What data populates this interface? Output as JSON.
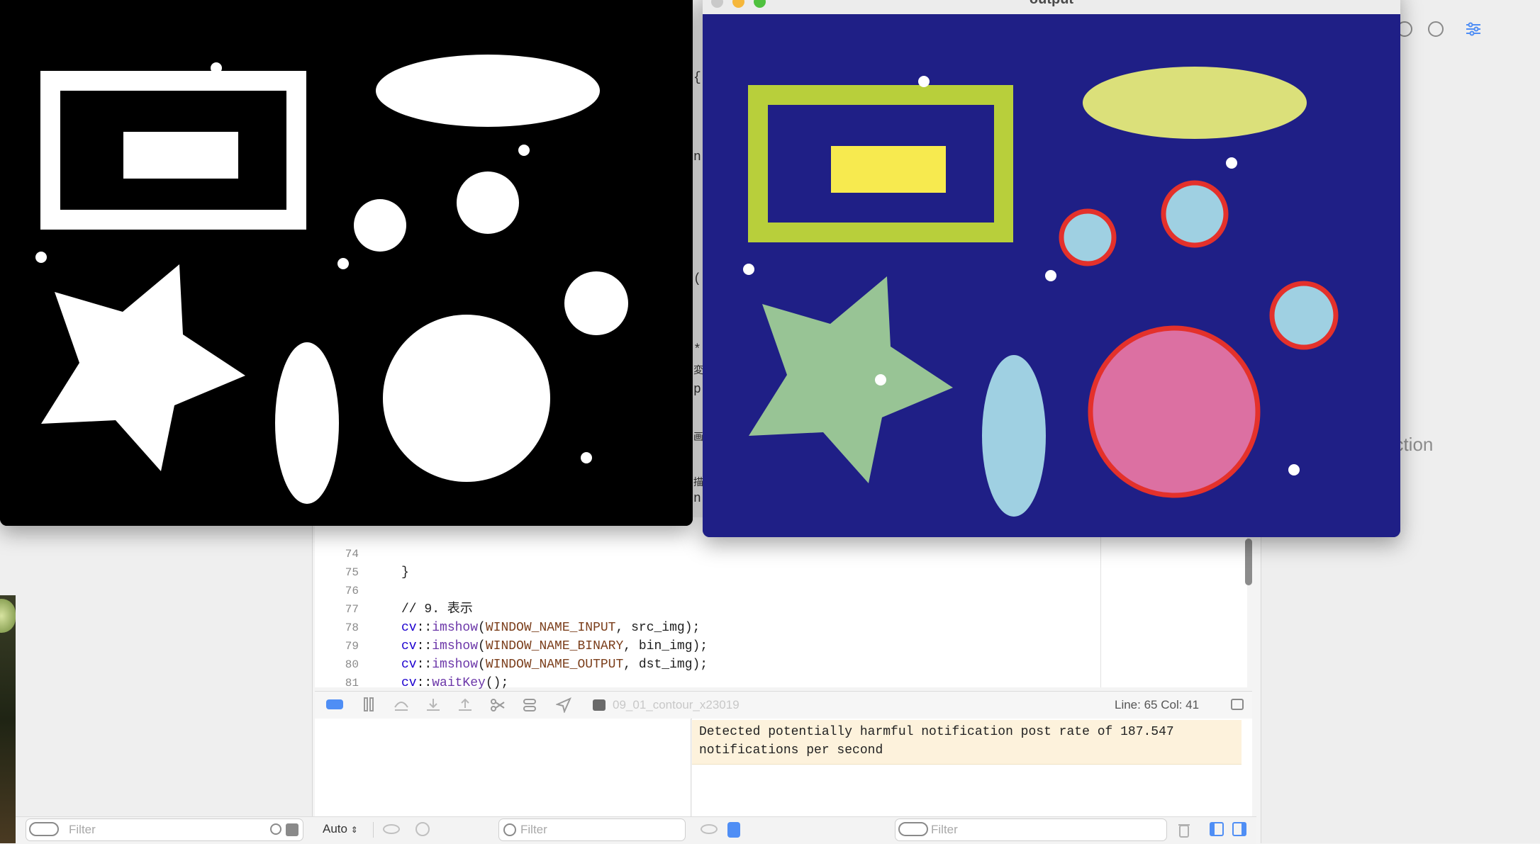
{
  "output_window": {
    "title": "output"
  },
  "editor": {
    "lines": [
      {
        "num": "74",
        "text": "}"
      },
      {
        "num": "75",
        "text": ""
      },
      {
        "num": "76",
        "comment": "// 9. 表示"
      },
      {
        "num": "77",
        "ns": "cv",
        "fn": "imshow",
        "arg1": "WINDOW_NAME_INPUT",
        "rest": ", src_img);"
      },
      {
        "num": "78",
        "ns": "cv",
        "fn": "imshow",
        "arg1": "WINDOW_NAME_BINARY",
        "rest": ", bin_img);"
      },
      {
        "num": "79",
        "ns": "cv",
        "fn": "imshow",
        "arg1": "WINDOW_NAME_OUTPUT",
        "rest": ", dst_img);"
      },
      {
        "num": "80",
        "ns": "cv",
        "fn": "waitKey",
        "arg1": "",
        "rest": "();"
      },
      {
        "num": "81",
        "text": ""
      }
    ],
    "partial_chars": [
      "{",
      "n",
      "(",
      "*",
      "変",
      "p",
      "画",
      "描",
      "n"
    ]
  },
  "debug_bar": {
    "scheme": "09_01_contour_x23019",
    "cursor": "Line: 65  Col: 41"
  },
  "console": {
    "message": "Detected potentially harmful notification post rate of 187.547 notifications per second"
  },
  "bottom_bar": {
    "left_filter_placeholder": "Filter",
    "auto_label": "Auto",
    "middle_filter_placeholder": "Filter",
    "right_filter_placeholder": "Filter"
  },
  "inspector": {
    "partial_text": "ection"
  },
  "colors": {
    "output_bg": "#1f1f86",
    "rect_frame": "#b8cf3b",
    "inner_rect": "#f7ea4f",
    "ellipse_top": "#dbe07a",
    "circle_fill": "#9fd0e2",
    "contour": "#e4312b",
    "big_circle": "#dc70a2",
    "star": "#98c495",
    "vertical_ellipse": "#9fd0e2",
    "dots": "#ffffff"
  }
}
